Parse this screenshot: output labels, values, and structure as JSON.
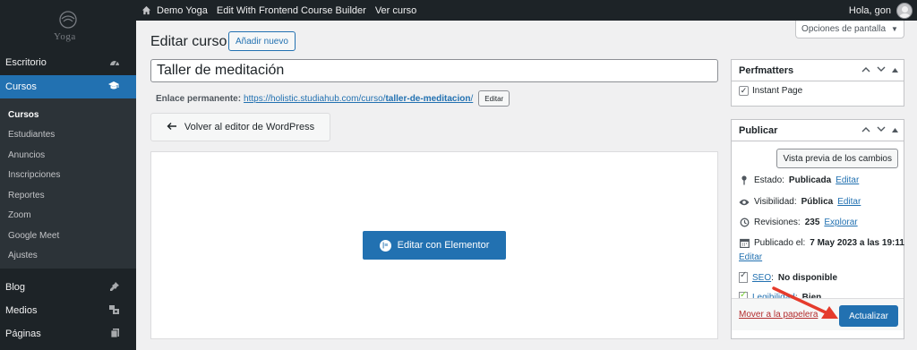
{
  "admin_bar": {
    "site_name": "Demo Yoga",
    "edit_frontend": "Edit With Frontend Course Builder",
    "view_course": "Ver curso",
    "greeting": "Hola, gon"
  },
  "sidebar": {
    "logo_text": "Yoga",
    "items": [
      {
        "label": "Escritorio",
        "icon": "dashboard-icon"
      },
      {
        "label": "Cursos",
        "icon": "graduation-cap-icon"
      },
      {
        "label": "Blog",
        "icon": "pin-icon"
      },
      {
        "label": "Medios",
        "icon": "media-icon"
      },
      {
        "label": "Páginas",
        "icon": "pages-icon"
      }
    ],
    "submenu": [
      "Cursos",
      "Estudiantes",
      "Anuncios",
      "Inscripciones",
      "Reportes",
      "Zoom",
      "Google Meet",
      "Ajustes"
    ]
  },
  "header": {
    "title": "Editar curso",
    "add_new": "Añadir nuevo",
    "screen_options": "Opciones de pantalla"
  },
  "editor": {
    "post_title": "Taller de meditación",
    "permalink_label": "Enlace permanente:",
    "permalink_base": "https://holistic.studiahub.com/curso/",
    "permalink_slug": "taller-de-meditacion",
    "permalink_trailing": "/",
    "edit_slug": "Editar",
    "back_to_wp": "Volver al editor de WordPress",
    "edit_elementor": "Editar con Elementor"
  },
  "perfmatters": {
    "title": "Perfmatters",
    "instant_page": "Instant Page",
    "instant_page_checked": true
  },
  "publish": {
    "title": "Publicar",
    "preview": "Vista previa de los cambios",
    "status_label": "Estado:",
    "status_value": "Publicada",
    "visibility_label": "Visibilidad:",
    "visibility_value": "Pública",
    "revisions_label": "Revisiones:",
    "revisions_value": "235",
    "explore": "Explorar",
    "edit": "Editar",
    "published_label": "Publicado el:",
    "published_value": "7 May 2023 a las 19:11",
    "seo_label": "SEO",
    "seo_value": "No disponible",
    "readability_label": "Legibilidad",
    "readability_value": "Bien",
    "trash": "Mover a la papelera",
    "update": "Actualizar"
  },
  "colors": {
    "accent": "#2271b1",
    "admin_dark": "#1d2327",
    "annotation_arrow": "#e53b2c"
  }
}
